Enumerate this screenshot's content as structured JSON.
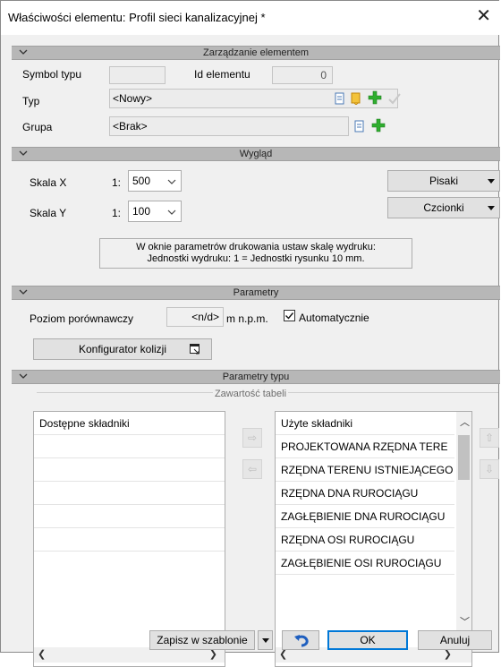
{
  "window": {
    "title": "Właściwości elementu: Profil sieci kanalizacyjnej *",
    "close_symbol": "✕"
  },
  "sections": {
    "management": "Zarządzanie elementem",
    "appearance": "Wygląd",
    "parameters": "Parametry",
    "type_parameters": "Parametry typu"
  },
  "management": {
    "symbol_label": "Symbol typu",
    "symbol_value": "",
    "id_label": "Id elementu",
    "id_value": "0",
    "type_label": "Typ",
    "type_value": "<Nowy>",
    "group_label": "Grupa",
    "group_value": "<Brak>"
  },
  "appearance": {
    "scale_x_label": "Skala X",
    "scale_x_prefix": "1:",
    "scale_x_value": "500",
    "scale_y_label": "Skala Y",
    "scale_y_prefix": "1:",
    "scale_y_value": "100",
    "pens_button": "Pisaki",
    "fonts_button": "Czcionki",
    "info_line1": "W oknie parametrów drukowania ustaw skalę wydruku:",
    "info_line2": "Jednostki wydruku: 1 = Jednostki rysunku 10 mm."
  },
  "parameters": {
    "level_label": "Poziom porównawczy",
    "level_value": "<n/d>",
    "level_unit": "m n.p.m.",
    "auto_label": "Automatycznie",
    "auto_checked": true,
    "collision_button": "Konfigurator kolizji"
  },
  "type_params": {
    "group_title": "Zawartość tabeli",
    "available_header": "Dostępne składniki",
    "used_header": "Użyte składniki",
    "used_items": [
      "PROJEKTOWANA RZĘDNA TERE",
      "RZĘDNA TERENU ISTNIEJĄCEGO",
      "RZĘDNA DNA RUROCIĄGU",
      "ZAGŁĘBIENIE DNA RUROCIĄGU",
      "RZĘDNA OSI RUROCIĄGU",
      "ZAGŁĘBIENIE OSI RUROCIĄGU"
    ]
  },
  "footer": {
    "save_template": "Zapisz w szablonie",
    "ok": "OK",
    "cancel": "Anuluj"
  },
  "colors": {
    "section_bar": "#b7b7b7",
    "window_bg": "#f0f0f0",
    "ok_border": "#0078d7",
    "accent_green": "#2fae2f"
  }
}
